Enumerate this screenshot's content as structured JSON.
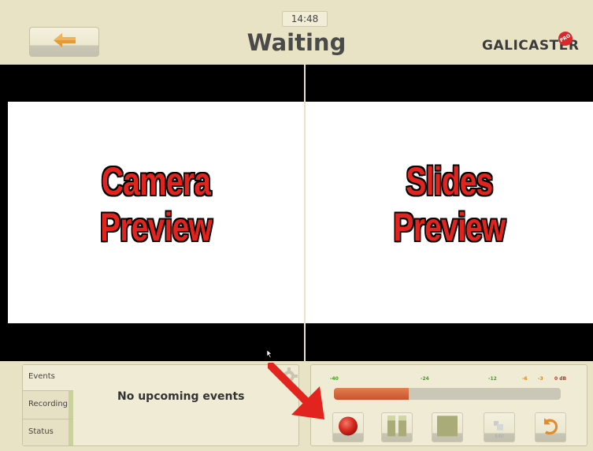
{
  "header": {
    "clock": "14:48",
    "title": "Waiting",
    "logo_text": "GALICASTER",
    "logo_badge": "PRO"
  },
  "previews": {
    "left_line1": "Camera",
    "left_line2": "Preview",
    "right_line1": "Slides",
    "right_line2": "Preview"
  },
  "events": {
    "tabs": [
      "Events",
      "Recording",
      "Status"
    ],
    "message": "No upcoming events"
  },
  "recorder": {
    "db_labels": [
      "-40",
      "-24",
      "-12",
      "-6",
      "-3",
      "0 dB"
    ],
    "level_fraction": 0.33,
    "edit_label": "Edit"
  },
  "colors": {
    "accent": "#e3231d",
    "meter_fill": "#d6653b",
    "background": "#e8e3c5"
  }
}
